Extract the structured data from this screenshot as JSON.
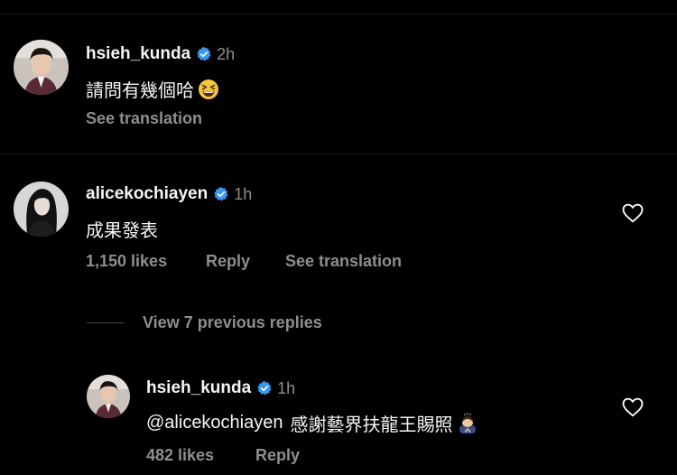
{
  "comments": [
    {
      "username": "hsieh_kunda",
      "time": "2h",
      "text": "請問有幾個哈",
      "emoji": "grinning-squinting-face",
      "see_translation": "See translation"
    },
    {
      "username": "alicekochiayen",
      "time": "1h",
      "text": "成果發表",
      "likes": "1,150 likes",
      "reply": "Reply",
      "see_translation": "See translation"
    }
  ],
  "view_replies": "View 7 previous replies",
  "reply": {
    "username": "hsieh_kunda",
    "time": "1h",
    "mention": "@alicekochiayen",
    "text": "感謝藝界扶龍王賜照",
    "emoji": "person-bowing",
    "likes": "482 likes",
    "reply": "Reply"
  },
  "colors": {
    "background": "#000000",
    "primary_text": "#f5f5f5",
    "secondary_text": "#8e8e8e",
    "verified_badge": "#3897f0"
  }
}
